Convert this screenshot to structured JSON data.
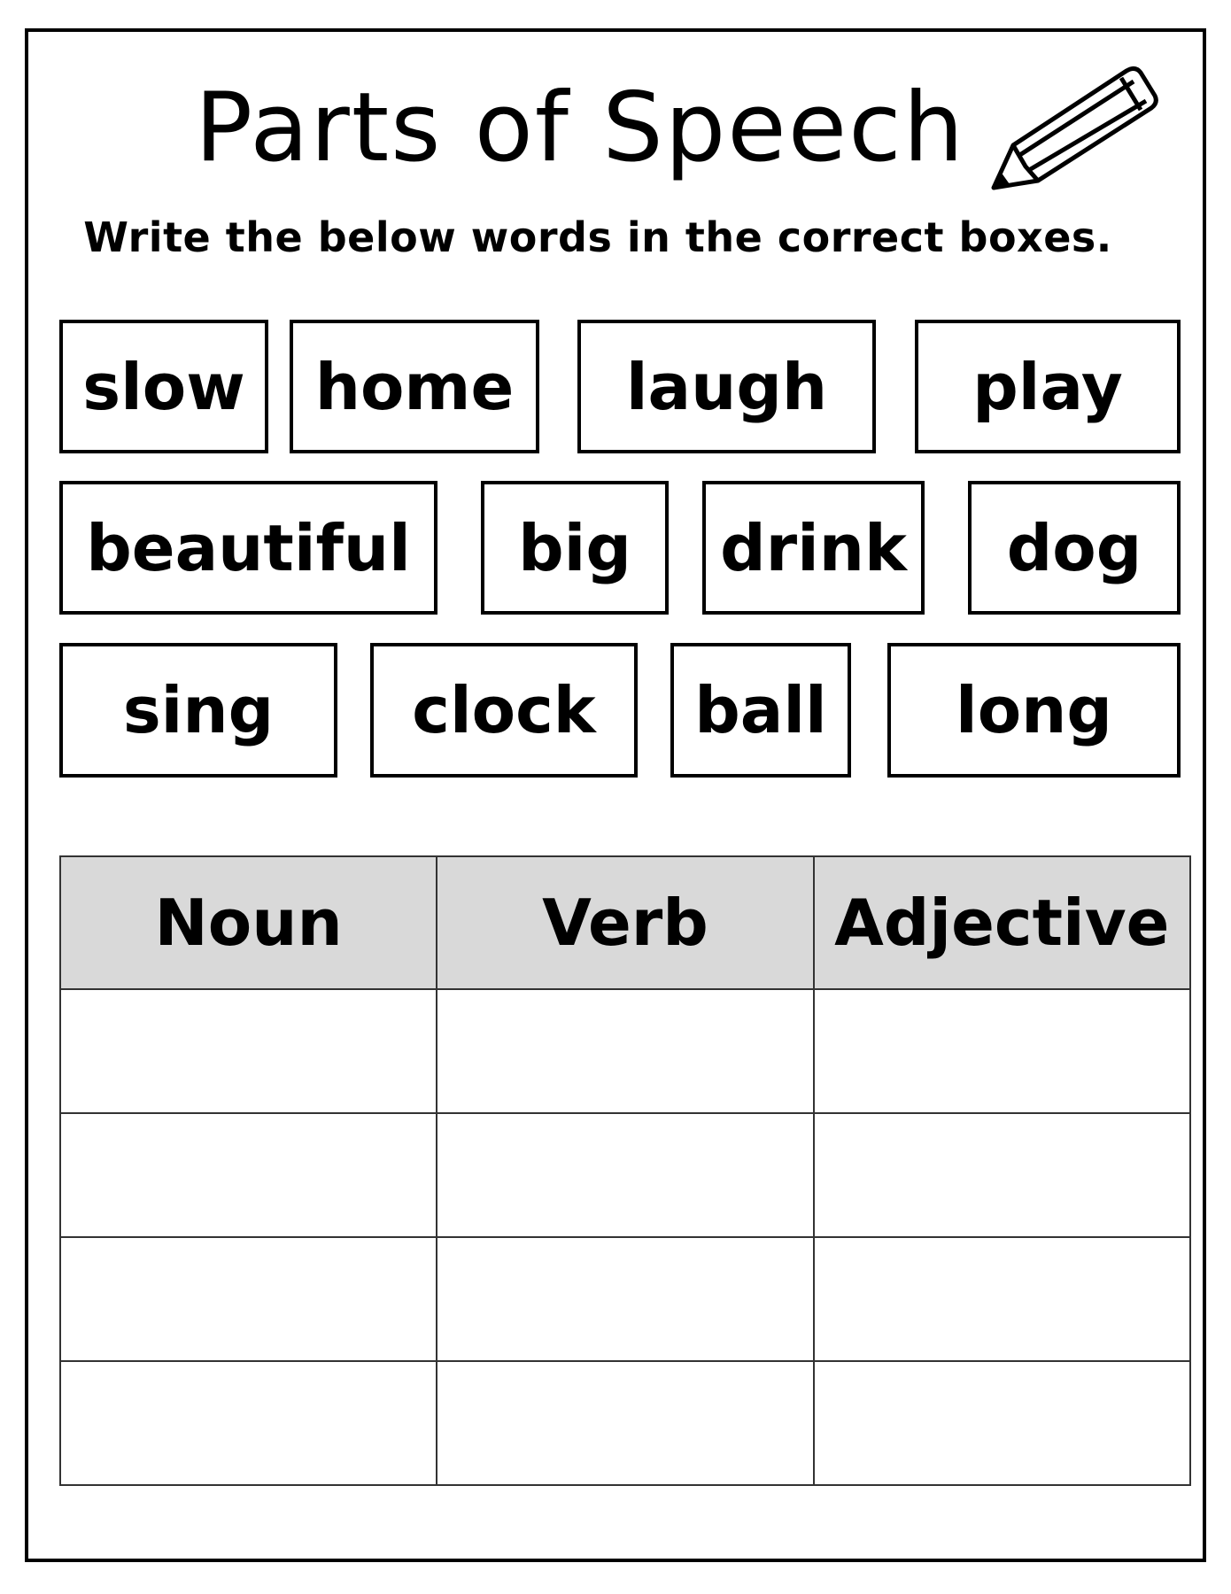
{
  "worksheet": {
    "title": "Parts of Speech",
    "instruction": "Write the below words in the correct boxes.",
    "icon": "pencil-icon",
    "word_bank": [
      [
        "slow",
        "home",
        "laugh",
        "play"
      ],
      [
        "beautiful",
        "big",
        "drink",
        "dog"
      ],
      [
        "sing",
        "clock",
        "ball",
        "long"
      ]
    ],
    "table": {
      "headers": [
        "Noun",
        "Verb",
        "Adjective"
      ],
      "empty_rows": 4
    }
  }
}
